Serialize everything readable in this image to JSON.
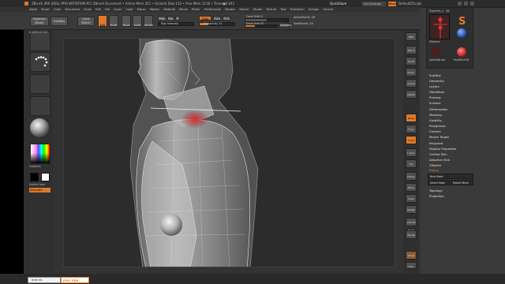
{
  "titlebar": {
    "title": "ZBrush 4R6 [DELL-PRO-WSTATION-PC]   ZBrush Document   • Active Mem 451 • Scratch Disk 152 • Free Mem 1118 • Timer●0.041",
    "quicksave": "QuickSave",
    "menus_label": "See-through",
    "default_label": "Menus",
    "default_script": "DefaultZScript"
  },
  "menubar": [
    "Alpha",
    "Brush",
    "Color",
    "Document",
    "Draw",
    "Edit",
    "File",
    "Layer",
    "Light",
    "Macro",
    "Marker",
    "Material",
    "Movie",
    "Picker",
    "Preferences",
    "Render",
    "Stencil",
    "Stroke",
    "Texture",
    "Tool",
    "Transform",
    "Zplugin",
    "Zscript"
  ],
  "topshelf": {
    "projection_master": "Projection Master",
    "lightbox": "LightBox",
    "quick_sketch": "Quick Sketch",
    "edit": "Edit",
    "draw": "Draw",
    "move": "Move",
    "scale": "Scale",
    "rotate": "Rotate",
    "mrgb": "Mrgb",
    "rgb": "Rgb",
    "m": "M",
    "zadd": "Zadd",
    "zsub": "Zsub",
    "zcut": "Zcut",
    "rgb_intensity": "Rgb Intensity",
    "z_intensity": "Z Intensity 25",
    "focal_shift": "Focal Shift 0",
    "draw_size": "Draw Size 32",
    "dynamic": "Dynamic",
    "active_points": "ActivePoints: 18",
    "total_points": "TotalPoints: 18"
  },
  "coords": "0.1495,0.518",
  "lefttray": {
    "gradient": "Gradient",
    "switch_color": "SwitchColor",
    "alternate": "Alternate"
  },
  "rightstrip": [
    "BPR",
    "SPix 3",
    "Scroll",
    "Zoom",
    "Actual",
    "AAHalf",
    "Persp",
    "Floor",
    "Local",
    "L.Sym",
    "Xyz",
    "Frame",
    "Move",
    "Scale",
    "Rotate",
    "Line Fill PolyF",
    "Transp",
    "Ghost",
    "Solo",
    "Xpose"
  ],
  "rightpanel": {
    "header": "Zspheres_1 · 48",
    "tools": [
      "ZSphere",
      "SphereBrush",
      "AlphaBrush",
      "SimpleBrush",
      "EraserBrush",
      "PolyMesh3D"
    ],
    "items": [
      "SubTool",
      "Geometry",
      "Layers",
      "FiberMesh",
      "Preview",
      "Surface",
      "Deformation",
      "Masking",
      "Visibility",
      "Polygroups",
      "Contact",
      "Morph Target",
      "Polypaint",
      "Display Properties",
      "Unified Skin",
      "Adaptive Skin",
      "ZSketch",
      "Rigging"
    ],
    "rigging_buttons": {
      "bind_mesh": "Bind Mesh",
      "select_mesh": "Select Mesh",
      "delete_mesh": "Delete Mesh"
    },
    "items_after": [
      "Topology",
      "Projection"
    ]
  },
  "bottom": {
    "search": "hide nb",
    "epic": "EPIC PEN"
  },
  "colors": {
    "accent": "#e07a2a",
    "panel": "#3a3a3a",
    "canvas": "#2c2c2c"
  }
}
